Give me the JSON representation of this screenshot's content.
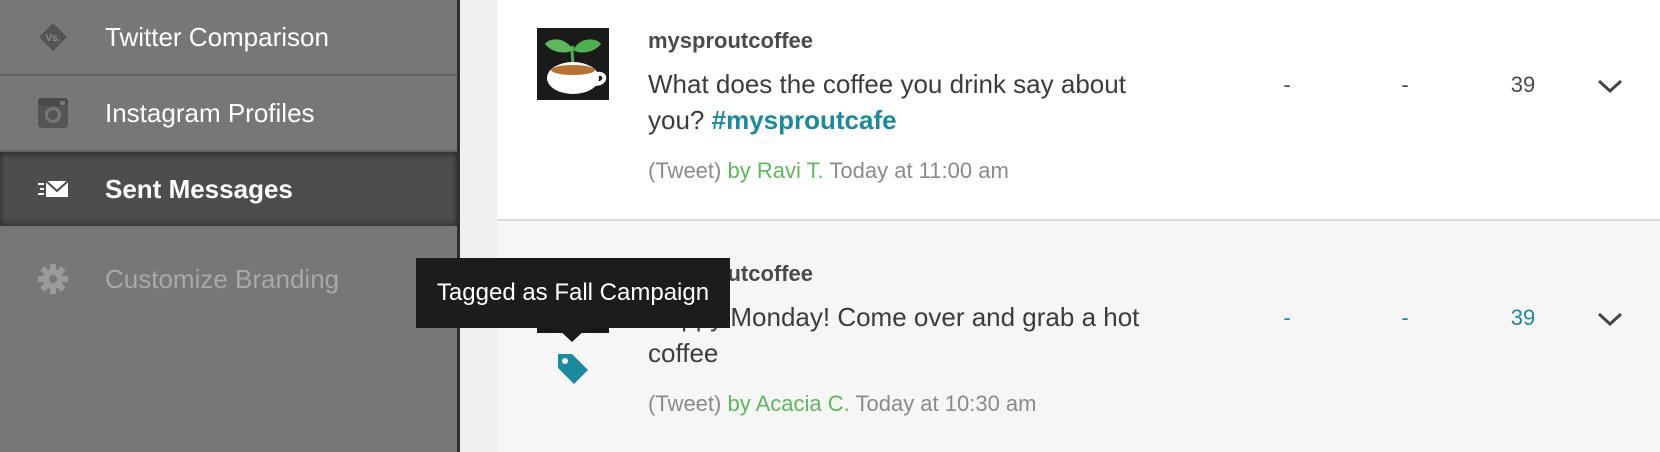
{
  "sidebar": {
    "items": [
      {
        "label": "Twitter Comparison",
        "icon": "vs-icon"
      },
      {
        "label": "Instagram Profiles",
        "icon": "instagram-icon"
      },
      {
        "label": "Sent Messages",
        "icon": "sent-envelope-icon",
        "active": true
      },
      {
        "label": "Customize Branding",
        "icon": "gear-icon",
        "disabled": true
      }
    ]
  },
  "messages": [
    {
      "account": "mysproutcoffee",
      "text": "What does the coffee you drink say about you?",
      "hashtag": "#mysproutcafe",
      "type": "(Tweet)",
      "author": "by Ravi T.",
      "time": "Today at 11:00 am",
      "stat1": "-",
      "stat2": "-",
      "stat3": "39"
    },
    {
      "account": "mysproutcoffee",
      "text": "Happy Monday! Come over and grab a hot coffee",
      "hashtag": "",
      "type": "(Tweet)",
      "author": "by Acacia C.",
      "time": "Today at 10:30 am",
      "stat1": "-",
      "stat2": "-",
      "stat3": "39"
    }
  ],
  "tooltip": {
    "text": "Tagged as Fall Campaign"
  },
  "colors": {
    "accent": "#1a8a9f",
    "author": "#5cb85c",
    "sidebar_bg": "#777777",
    "sidebar_active": "#4d4d4d"
  }
}
